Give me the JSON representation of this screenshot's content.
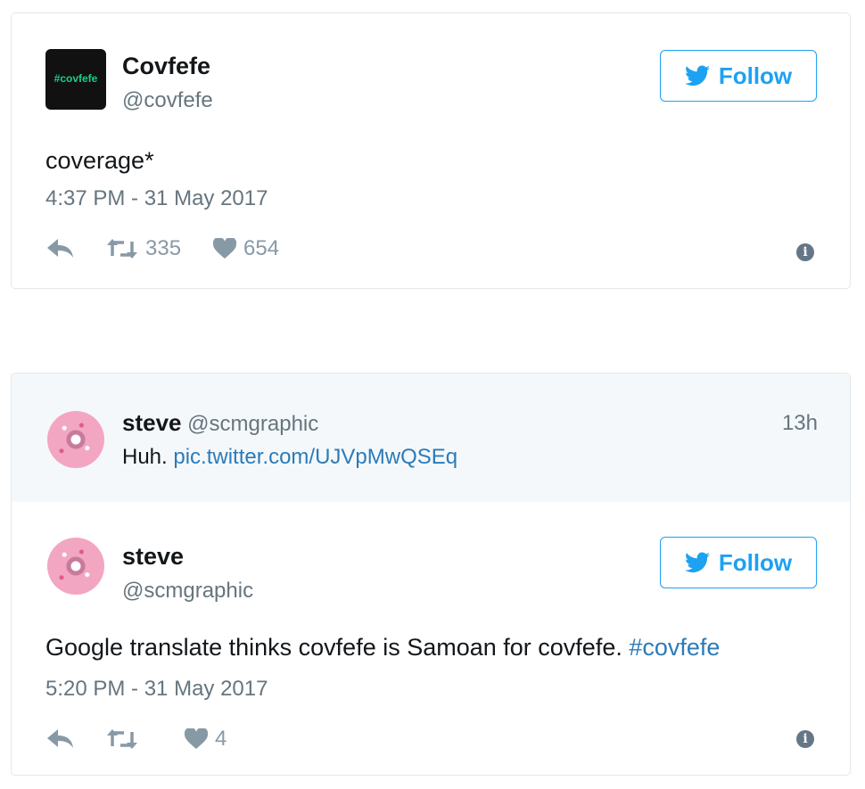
{
  "tweets": [
    {
      "name": "Covfefe",
      "handle": "@covfefe",
      "avatar_text": "#covfefe",
      "follow_label": "Follow",
      "text": "coverage*",
      "timestamp": "4:37 PM - 31 May 2017",
      "retweets": "335",
      "likes": "654"
    }
  ],
  "reply_context": {
    "name": "steve",
    "handle": "@scmgraphic",
    "age": "13h",
    "text_prefix": "Huh.",
    "link": "pic.twitter.com/UJVpMwQSEq"
  },
  "tweet2": {
    "name": "steve",
    "handle": "@scmgraphic",
    "follow_label": "Follow",
    "text": "Google translate thinks covfefe is Samoan for covfefe.",
    "hashtag": "#covfefe",
    "timestamp": "5:20 PM - 31 May 2017",
    "retweets": "",
    "likes": "4"
  },
  "colors": {
    "follow_blue": "#1da1f2",
    "link_blue": "#2b7bb9",
    "muted": "#66757f",
    "icon_gray": "#8899a6",
    "avatar_green": "#19cf86"
  },
  "icons": [
    "reply-icon",
    "retweet-icon",
    "heart-icon",
    "info-icon",
    "twitter-bird-icon"
  ]
}
